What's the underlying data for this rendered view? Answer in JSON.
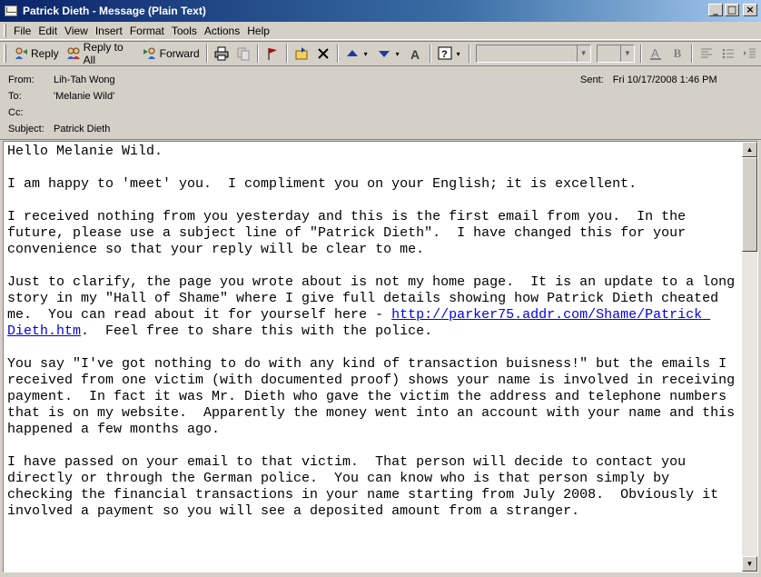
{
  "window": {
    "title": "Patrick Dieth - Message (Plain Text)"
  },
  "menu": [
    "File",
    "Edit",
    "View",
    "Insert",
    "Format",
    "Tools",
    "Actions",
    "Help"
  ],
  "toolbar": {
    "reply": "Reply",
    "reply_all": "Reply to All",
    "forward": "Forward"
  },
  "header": {
    "from_label": "From:",
    "from": "Lih-Tah Wong",
    "to_label": "To:",
    "to": "'Melanie Wild'",
    "cc_label": "Cc:",
    "cc": "",
    "subject_label": "Subject:",
    "subject": "Patrick Dieth",
    "sent_label": "Sent:",
    "sent": "Fri 10/17/2008 1:46 PM"
  },
  "message": {
    "p1": "Hello Melanie Wild.",
    "p2": "I am happy to 'meet' you.  I compliment you on your English; it is excellent.",
    "p3": "I received nothing from you yesterday and this is the first email from you.  In the future, please use a subject line of \"Patrick Dieth\".  I have changed this for your convenience so that your reply will be clear to me.",
    "p4a": "Just to clarify, the page you wrote about is not my home page.  It is an update to a long story in my \"Hall of Shame\" where I give full details showing how Patrick Dieth cheated me.  You can read about it for yourself here - ",
    "link": "http://parker75.addr.com/Shame/Patrick Dieth.htm",
    "p4b": ".  Feel free to share this with the police.",
    "p5": "You say \"I've got nothing to do with any kind of transaction buisness!\" but the emails I received from one victim (with documented proof) shows your name is involved in receiving payment.  In fact it was Mr. Dieth who gave the victim the address and telephone numbers that is on my website.  Apparently the money went into an account with your name and this happened a few months ago.",
    "p6": "I have passed on your email to that victim.  That person will decide to contact you directly or through the German police.  You can know who is that person simply by checking the financial transactions in your name starting from July 2008.  Obviously it involved a payment so you will see a deposited amount from a stranger."
  }
}
